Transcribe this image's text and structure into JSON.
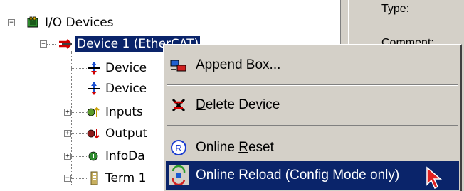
{
  "tree": {
    "root": {
      "label": "I/O Devices",
      "icon": "io-devices-icon"
    },
    "device": {
      "label": "Device 1 (EtherCAT)",
      "icon": "ethercat-device-icon"
    },
    "children": [
      {
        "label": "Device",
        "icon": "device-image-icon",
        "expander": ""
      },
      {
        "label": "Device",
        "icon": "device-image-info-icon",
        "expander": ""
      },
      {
        "label": "Inputs",
        "icon": "inputs-icon",
        "expander": "+"
      },
      {
        "label": "Output",
        "icon": "outputs-icon",
        "expander": "+"
      },
      {
        "label": "InfoDa",
        "icon": "infodata-icon",
        "expander": "+"
      },
      {
        "label": "Term 1",
        "icon": "terminal-icon",
        "expander": "−"
      }
    ]
  },
  "right_pane": {
    "type_label": "Type:",
    "comment_label": "Comment:"
  },
  "context_menu": {
    "items": [
      {
        "pre": "Append ",
        "key": "B",
        "post": "ox...",
        "icon": "append-box-icon"
      },
      {
        "pre": "",
        "key": "D",
        "post": "elete Device",
        "icon": "delete-device-icon"
      },
      {
        "pre": "Online ",
        "key": "R",
        "post": "eset",
        "icon": "online-reset-icon"
      },
      {
        "pre": "Online Reload (Config Mode only)",
        "key": "",
        "post": "",
        "icon": "online-reload-icon"
      }
    ]
  },
  "colors": {
    "selection": "#0a246a",
    "menu_bg": "#d4d0c8",
    "cursor": "#e02020"
  }
}
